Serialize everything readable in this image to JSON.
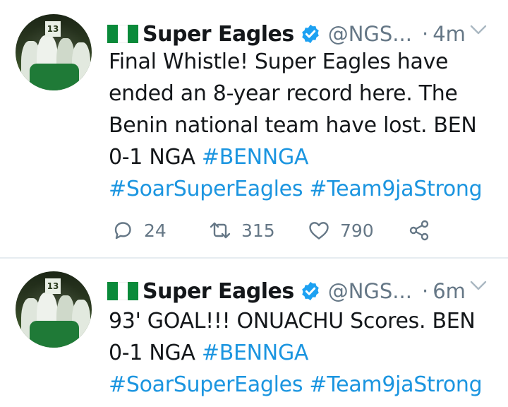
{
  "tweets": [
    {
      "author": "Super Eagles",
      "handle": "@NGS...",
      "separator": "·",
      "time": "4m",
      "avatar_number": "13",
      "lines": [
        [
          {
            "t": "Final Whistle! Super Eagles have"
          }
        ],
        [
          {
            "t": "ended an 8-year record here. The"
          }
        ],
        [
          {
            "t": "Benin national team have lost. BEN"
          }
        ],
        [
          {
            "t": "0-1 NGA "
          },
          {
            "t": "#BENNGA",
            "tag": true
          }
        ],
        [
          {
            "t": "#SoarSuperEagles",
            "tag": true
          },
          {
            "t": " "
          },
          {
            "t": "#Team9jaStrong",
            "tag": true
          }
        ]
      ],
      "actions": {
        "reply_count": "24",
        "retweet_count": "315",
        "like_count": "790"
      }
    },
    {
      "author": "Super Eagles",
      "handle": "@NGS...",
      "separator": "·",
      "time": "6m",
      "avatar_number": "13",
      "lines": [
        [
          {
            "t": "93' GOAL!!! ONUACHU Scores. BEN"
          }
        ],
        [
          {
            "t": "0-1 NGA "
          },
          {
            "t": "#BENNGA",
            "tag": true
          }
        ],
        [
          {
            "t": "#SoarSuperEagles",
            "tag": true
          },
          {
            "t": " "
          },
          {
            "t": "#Team9jaStrong",
            "tag": true
          }
        ]
      ]
    }
  ],
  "icons": {
    "flag": "nigeria-flag-icon",
    "verified": "verified-badge-icon",
    "caret": "chevron-down-icon",
    "reply": "reply-icon",
    "retweet": "retweet-icon",
    "like": "heart-icon",
    "share": "share-icon"
  },
  "colors": {
    "hashtag": "#1b95e0",
    "verified": "#1da1f2",
    "secondary_text": "#657786",
    "flag_green": "#0a8a3a"
  }
}
